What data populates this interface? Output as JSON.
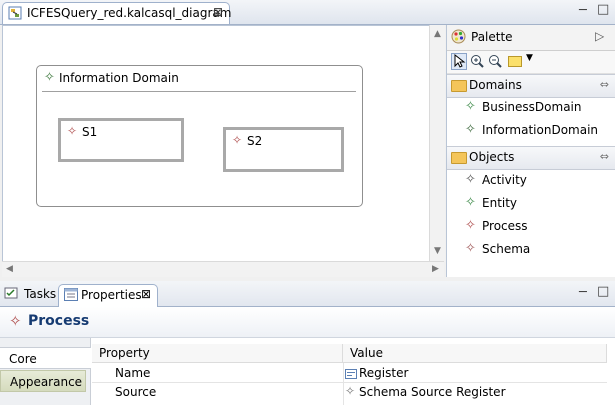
{
  "editor": {
    "tab_title": "ICFESQuery_red.kalcasql_diagram",
    "close_glyph": "⊠",
    "minimize_glyph": "─",
    "maximize_glyph": "□"
  },
  "diagram": {
    "group_label": "Information Domain",
    "nodes": [
      {
        "label": "S1"
      },
      {
        "label": "S2"
      }
    ]
  },
  "palette": {
    "title": "Palette",
    "collapse_glyph": "▷",
    "drawers": [
      {
        "label": "Domains",
        "items": [
          "BusinessDomain",
          "InformationDomain"
        ]
      },
      {
        "label": "Objects",
        "items": [
          "Activity",
          "Entity",
          "Process",
          "Schema"
        ]
      }
    ]
  },
  "bottom": {
    "tabs": [
      {
        "label": "Tasks"
      },
      {
        "label": "Properties",
        "close_glyph": "⊠"
      }
    ]
  },
  "properties": {
    "title": "Process",
    "side_tabs": [
      "Core",
      "Appearance"
    ],
    "columns": [
      "Property",
      "Value"
    ],
    "rows": [
      {
        "property": "Name",
        "value": "Register"
      },
      {
        "property": "Source",
        "value": "Schema Source Register"
      }
    ]
  },
  "colors": {
    "accent": "#163b72",
    "tab_border": "#9fb1cc",
    "folder": "#f4c55a"
  },
  "icons": {
    "editor_tab": "diagram-file-icon",
    "group": "information-domain-icon",
    "node": "schema-icon",
    "palette": "palette-icon",
    "properties": "properties-icon",
    "tasks": "tasks-icon"
  }
}
